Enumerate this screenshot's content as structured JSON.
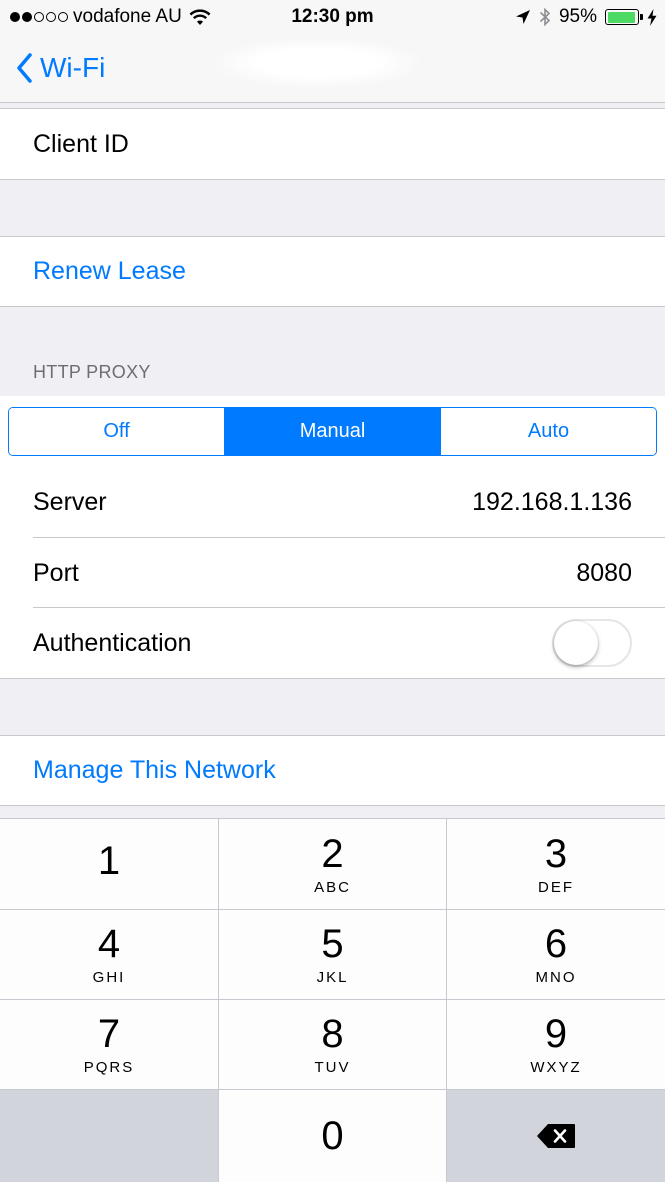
{
  "status_bar": {
    "carrier": "vodafone AU",
    "time": "12:30 pm",
    "battery_percent": "95%",
    "battery_level": 0.95,
    "signal_bars_total": 5,
    "signal_bars_on": 2
  },
  "nav": {
    "back_label": "Wi-Fi"
  },
  "rows": {
    "client_id_label": "Client ID",
    "renew_lease_label": "Renew Lease",
    "http_proxy_header": "HTTP PROXY",
    "proxy_modes": [
      "Off",
      "Manual",
      "Auto"
    ],
    "proxy_selected": "Manual",
    "server_label": "Server",
    "server_value": "192.168.1.136",
    "port_label": "Port",
    "port_value": "8080",
    "authentication_label": "Authentication",
    "authentication_on": false,
    "manage_network_label": "Manage This Network"
  },
  "keypad": {
    "keys": [
      {
        "num": "1",
        "letters": ""
      },
      {
        "num": "2",
        "letters": "ABC"
      },
      {
        "num": "3",
        "letters": "DEF"
      },
      {
        "num": "4",
        "letters": "GHI"
      },
      {
        "num": "5",
        "letters": "JKL"
      },
      {
        "num": "6",
        "letters": "MNO"
      },
      {
        "num": "7",
        "letters": "PQRS"
      },
      {
        "num": "8",
        "letters": "TUV"
      },
      {
        "num": "9",
        "letters": "WXYZ"
      },
      {
        "num": "0",
        "letters": ""
      }
    ],
    "backspace_icon": "backspace-icon"
  },
  "colors": {
    "accent": "#007aff",
    "battery": "#4cd964",
    "background": "#efeff4"
  }
}
